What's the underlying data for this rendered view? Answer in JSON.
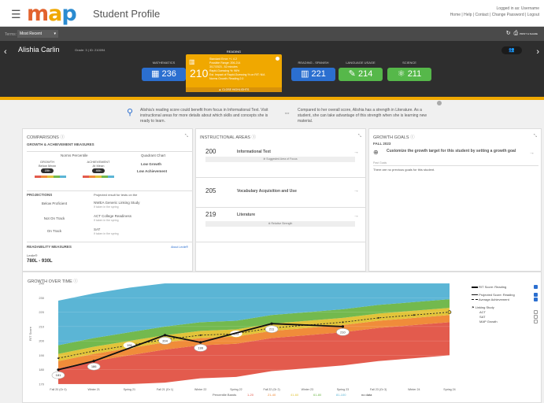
{
  "header": {
    "title": "Student Profile",
    "logged_in": "Logged in as: Username",
    "links": "Home  |  Help  |  Contact  |  Change Password  |  Logout"
  },
  "nav": {
    "terms_label": "Terms:",
    "terms_value": "Most Recent",
    "print_label": "PRINT & SHARE"
  },
  "student": {
    "name": "Alishia Carlin",
    "grade": "Grade: 3  |  ID: 210094"
  },
  "subjects": [
    {
      "name": "MATHEMATICS",
      "score": "236",
      "color": "#2b6fd0"
    },
    {
      "name": "READING - SPANISH",
      "score": "221",
      "color": "#2b6fd0"
    },
    {
      "name": "LANGUAGE USAGE",
      "score": "214",
      "color": "#56b84a"
    },
    {
      "name": "SCIENCE",
      "score": "211",
      "color": "#56b84a"
    }
  ],
  "reading": {
    "title": "READING",
    "score": "210",
    "details": [
      "Standard Error: +/- 4.2",
      "Possible Range: 206-214",
      "3/17/2023 - 52 minutes",
      "Rapid-Guessing %: 96%",
      "Est. Impact of Rapid-Guessing % on RIT: N/A",
      "Norms Growth: Reading 2.0"
    ],
    "close_label": "▲ CLOSE HIGHLIGHTS"
  },
  "insights": [
    "Alishia's reading score could benefit from focus in Informational Text. Visit instructional areas for more details about which skills and concepts she is ready to learn.",
    "Compared to her overall score, Alishia has a strength in Literature. As a student, she can take advantage of this strength when she is learning new material."
  ],
  "comparisons": {
    "title": "COMPARISONS",
    "subtitle": "GROWTH & ACHIEVEMENT MEASURES",
    "norms": "Norms Percentile",
    "quadrant": "Quadrant Chart",
    "growth_label": "GROWTH",
    "growth_level": "Below Mean",
    "growth_pct": "18th",
    "ach_label": "ACHIEVEMENT",
    "ach_level": "At Mean",
    "ach_pct": "46th",
    "q1": "Low Growth",
    "q2": "Low Achievement",
    "projections_title": "PROJECTIONS",
    "projections_note": "Projected result for tests on the",
    "rows": [
      {
        "status": "Below Proficient",
        "test": "NWEA Generic Linking Study",
        "sub": "If taken in the spring"
      },
      {
        "status": "Not On Track",
        "test": "ACT College Readiness",
        "sub": "If taken in the spring"
      },
      {
        "status": "On Track",
        "test": "SAT",
        "sub": "If taken in the spring"
      }
    ],
    "readability_title": "READABILITY MEASURES",
    "readability_link": "About Lexile®",
    "lexile_label": "Lexile®",
    "lexile_range": "780L - 930L"
  },
  "instructional": {
    "title": "INSTRUCTIONAL AREAS",
    "areas": [
      {
        "score": "200",
        "name": "Informational Text",
        "note": "Suggested Area of Focus"
      },
      {
        "score": "205",
        "name": "Vocabulary Acquisition and Use",
        "note": ""
      },
      {
        "score": "219",
        "name": "Literature",
        "note": "Relative Strength"
      }
    ]
  },
  "goals": {
    "title": "GROWTH GOALS",
    "term": "FALL 2023",
    "prompt": "Customize the growth target for this student by setting a growth goal",
    "past": "Past Goals",
    "none": "There are no previous goals for this student."
  },
  "growth": {
    "title": "GROWTH OVER TIME",
    "legend": {
      "rit": "RIT Score: Reading",
      "projected": "Projected Score: Reading",
      "average": "Average Achievement",
      "linking": "Linking Study",
      "act": "ACT",
      "sat": "SAT",
      "map": "MAP Growth"
    },
    "percentile_label": "Percentile Bands",
    "bands": [
      {
        "label": "1-20",
        "color": "#e35b4d"
      },
      {
        "label": "21-40",
        "color": "#f08c3a"
      },
      {
        "label": "41-60",
        "color": "#e2c43a"
      },
      {
        "label": "61-80",
        "color": "#73b94e"
      },
      {
        "label": "81-100",
        "color": "#5bb5d5"
      },
      {
        "label": "no data",
        "color": "#333333"
      }
    ]
  },
  "chart_data": {
    "type": "line",
    "x": [
      "Fall 20 (Gr 0)",
      "Winter 21",
      "Spring 21",
      "Fall 21 (Gr 1)",
      "Winter 22",
      "Spring 22",
      "Fall 22 (Gr 2)",
      "Winter 23",
      "Spring 23",
      "Fall 23 (Gr 3)",
      "Winter 24",
      "Spring 24"
    ],
    "ylabel": "RIT Score",
    "ylim": [
      170,
      240
    ],
    "yticks": [
      170,
      180,
      190,
      200,
      210,
      220,
      230,
      240
    ],
    "series": [
      {
        "name": "RIT Score: Reading",
        "values": [
          180,
          186,
          null,
          204,
          199,
          null,
          212,
          null,
          210,
          null,
          null,
          null
        ],
        "labels": [
          "181",
          "186",
          "",
          "204",
          "199",
          "",
          "211",
          "",
          "210",
          "",
          "",
          ""
        ]
      },
      {
        "name": "Average Achievement",
        "values": [
          188,
          193,
          197,
          201,
          204,
          205,
          209,
          211,
          213,
          216,
          218,
          220
        ],
        "labels": [
          "",
          "",
          "196",
          "",
          "",
          "203",
          "",
          "",
          "",
          "",
          "",
          ""
        ]
      }
    ]
  }
}
